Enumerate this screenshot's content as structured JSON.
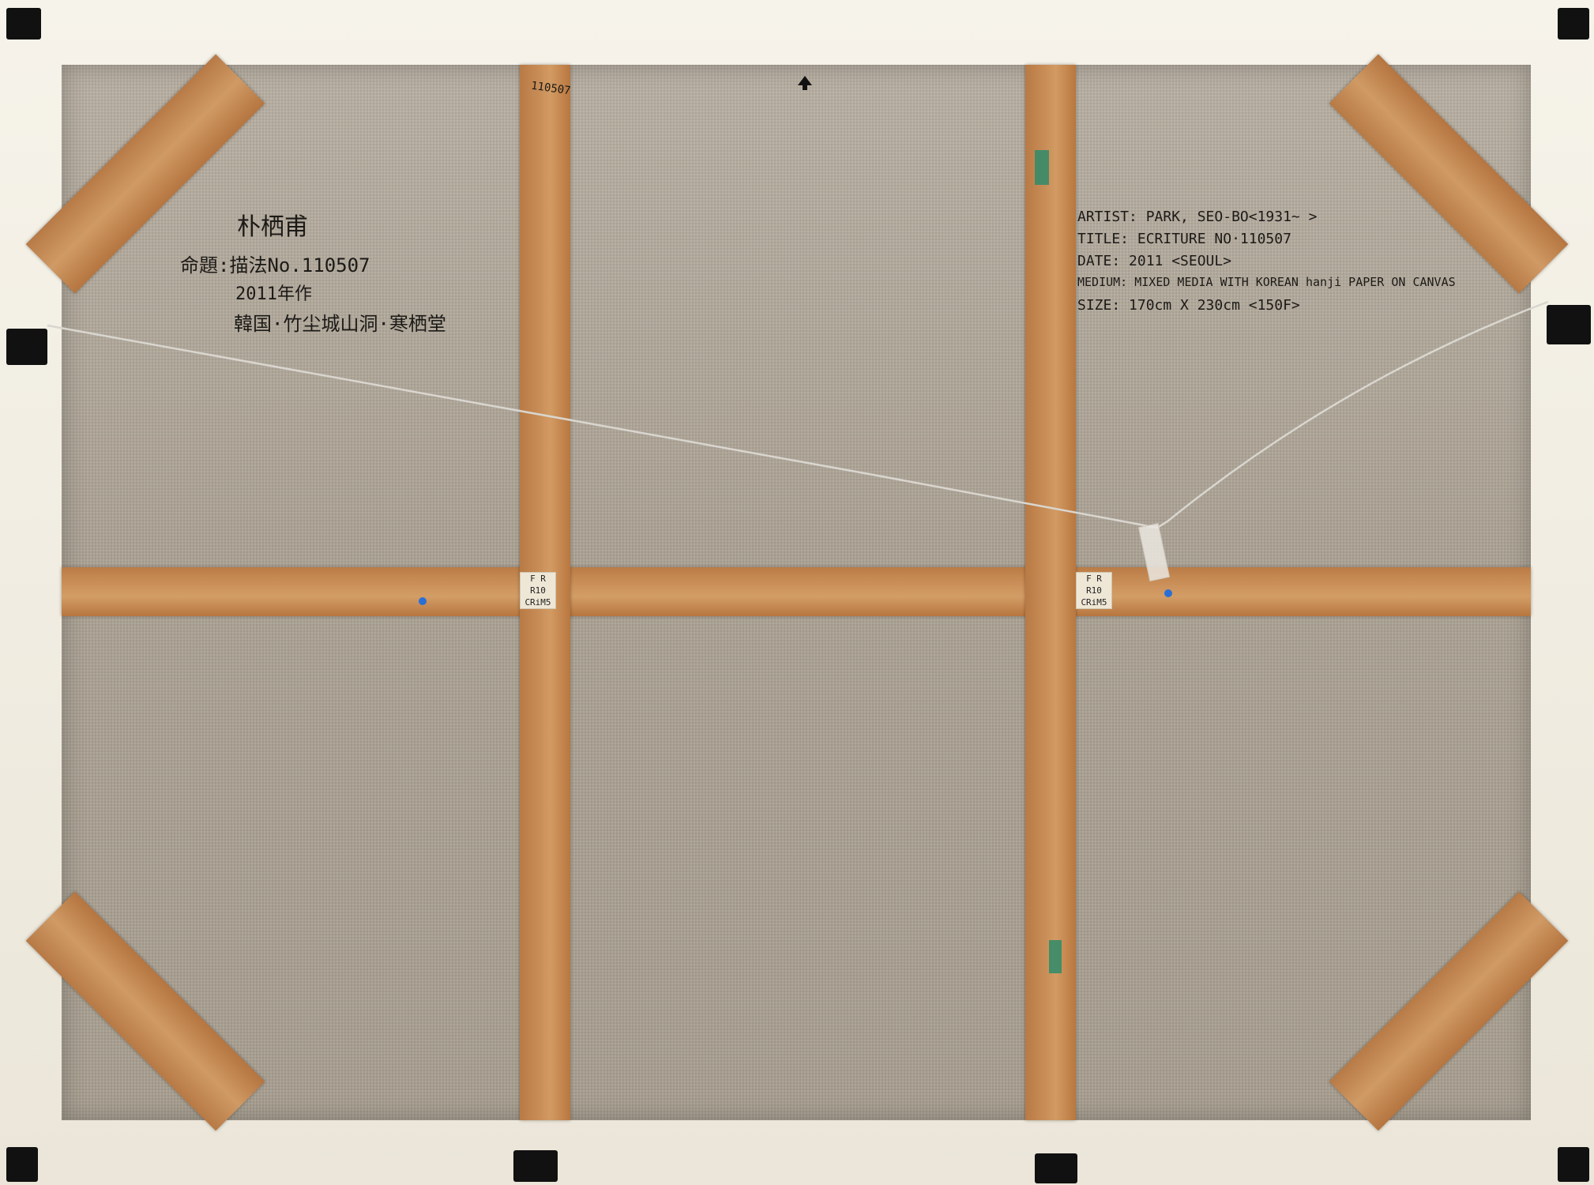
{
  "korean_inscription": {
    "artist_name": "朴栖甫",
    "title_line": "命題:描法No.110507",
    "year_line": "2011年作",
    "place_line": "韓国·竹尘城山洞·寒栖堂"
  },
  "english_inscription": {
    "artist_line": "ARTIST: PARK, SEO-BO<1931~          >",
    "title_line": "TITLE: ECRITURE NO·110507",
    "date_line": "DATE: 2011 <SEOUL>",
    "medium_line": "MEDIUM: MIXED MEDIA WITH KOREAN hanji PAPER ON CANVAS",
    "size_line": "SIZE: 170cm X 230cm <150F>"
  },
  "stretcher_number": "110507",
  "tag_left": {
    "line1": "F R",
    "line2": "R10",
    "line3": "CRiM5"
  },
  "tag_right": {
    "line1": "F R",
    "line2": "R10",
    "line3": "CRiM5"
  },
  "colors": {
    "wood": "#c98e58",
    "linen": "#aca395",
    "frame": "#f2efe6",
    "dot": "#2b6fd6"
  }
}
